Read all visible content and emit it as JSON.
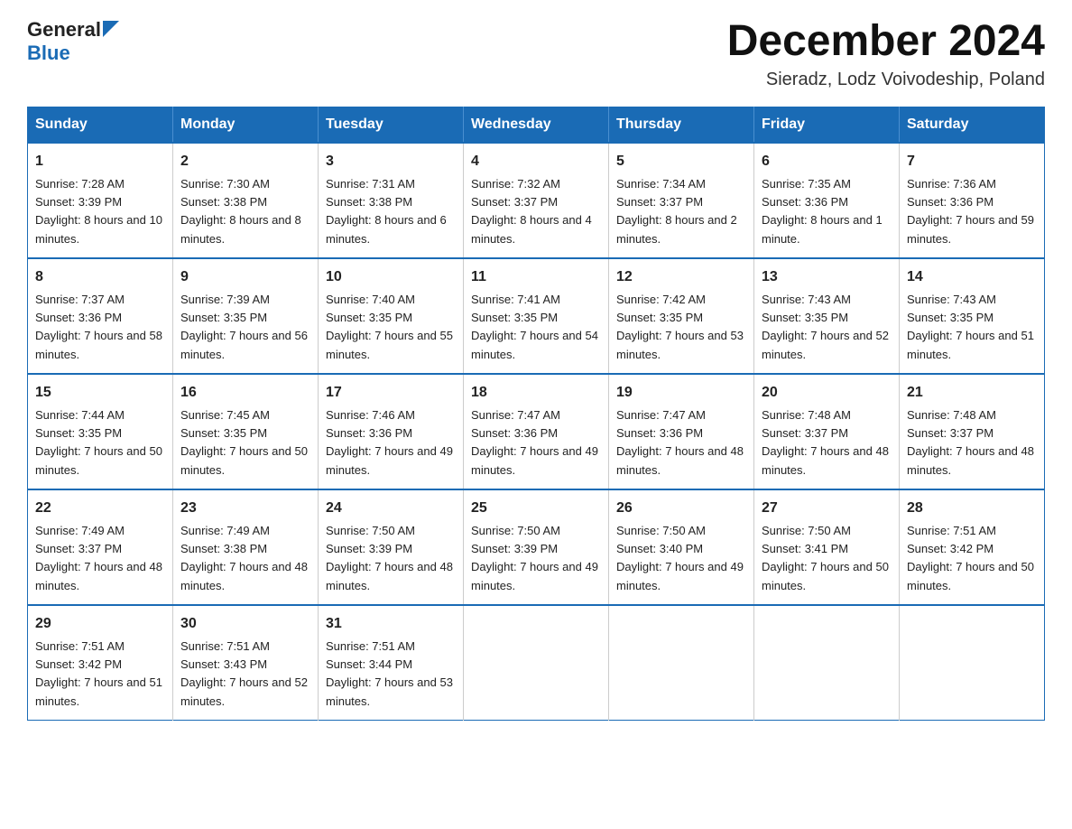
{
  "header": {
    "logo_general": "General",
    "logo_blue": "Blue",
    "title": "December 2024",
    "subtitle": "Sieradz, Lodz Voivodeship, Poland"
  },
  "weekdays": [
    "Sunday",
    "Monday",
    "Tuesday",
    "Wednesday",
    "Thursday",
    "Friday",
    "Saturday"
  ],
  "weeks": [
    [
      {
        "day": "1",
        "sunrise": "7:28 AM",
        "sunset": "3:39 PM",
        "daylight": "8 hours and 10 minutes."
      },
      {
        "day": "2",
        "sunrise": "7:30 AM",
        "sunset": "3:38 PM",
        "daylight": "8 hours and 8 minutes."
      },
      {
        "day": "3",
        "sunrise": "7:31 AM",
        "sunset": "3:38 PM",
        "daylight": "8 hours and 6 minutes."
      },
      {
        "day": "4",
        "sunrise": "7:32 AM",
        "sunset": "3:37 PM",
        "daylight": "8 hours and 4 minutes."
      },
      {
        "day": "5",
        "sunrise": "7:34 AM",
        "sunset": "3:37 PM",
        "daylight": "8 hours and 2 minutes."
      },
      {
        "day": "6",
        "sunrise": "7:35 AM",
        "sunset": "3:36 PM",
        "daylight": "8 hours and 1 minute."
      },
      {
        "day": "7",
        "sunrise": "7:36 AM",
        "sunset": "3:36 PM",
        "daylight": "7 hours and 59 minutes."
      }
    ],
    [
      {
        "day": "8",
        "sunrise": "7:37 AM",
        "sunset": "3:36 PM",
        "daylight": "7 hours and 58 minutes."
      },
      {
        "day": "9",
        "sunrise": "7:39 AM",
        "sunset": "3:35 PM",
        "daylight": "7 hours and 56 minutes."
      },
      {
        "day": "10",
        "sunrise": "7:40 AM",
        "sunset": "3:35 PM",
        "daylight": "7 hours and 55 minutes."
      },
      {
        "day": "11",
        "sunrise": "7:41 AM",
        "sunset": "3:35 PM",
        "daylight": "7 hours and 54 minutes."
      },
      {
        "day": "12",
        "sunrise": "7:42 AM",
        "sunset": "3:35 PM",
        "daylight": "7 hours and 53 minutes."
      },
      {
        "day": "13",
        "sunrise": "7:43 AM",
        "sunset": "3:35 PM",
        "daylight": "7 hours and 52 minutes."
      },
      {
        "day": "14",
        "sunrise": "7:43 AM",
        "sunset": "3:35 PM",
        "daylight": "7 hours and 51 minutes."
      }
    ],
    [
      {
        "day": "15",
        "sunrise": "7:44 AM",
        "sunset": "3:35 PM",
        "daylight": "7 hours and 50 minutes."
      },
      {
        "day": "16",
        "sunrise": "7:45 AM",
        "sunset": "3:35 PM",
        "daylight": "7 hours and 50 minutes."
      },
      {
        "day": "17",
        "sunrise": "7:46 AM",
        "sunset": "3:36 PM",
        "daylight": "7 hours and 49 minutes."
      },
      {
        "day": "18",
        "sunrise": "7:47 AM",
        "sunset": "3:36 PM",
        "daylight": "7 hours and 49 minutes."
      },
      {
        "day": "19",
        "sunrise": "7:47 AM",
        "sunset": "3:36 PM",
        "daylight": "7 hours and 48 minutes."
      },
      {
        "day": "20",
        "sunrise": "7:48 AM",
        "sunset": "3:37 PM",
        "daylight": "7 hours and 48 minutes."
      },
      {
        "day": "21",
        "sunrise": "7:48 AM",
        "sunset": "3:37 PM",
        "daylight": "7 hours and 48 minutes."
      }
    ],
    [
      {
        "day": "22",
        "sunrise": "7:49 AM",
        "sunset": "3:37 PM",
        "daylight": "7 hours and 48 minutes."
      },
      {
        "day": "23",
        "sunrise": "7:49 AM",
        "sunset": "3:38 PM",
        "daylight": "7 hours and 48 minutes."
      },
      {
        "day": "24",
        "sunrise": "7:50 AM",
        "sunset": "3:39 PM",
        "daylight": "7 hours and 48 minutes."
      },
      {
        "day": "25",
        "sunrise": "7:50 AM",
        "sunset": "3:39 PM",
        "daylight": "7 hours and 49 minutes."
      },
      {
        "day": "26",
        "sunrise": "7:50 AM",
        "sunset": "3:40 PM",
        "daylight": "7 hours and 49 minutes."
      },
      {
        "day": "27",
        "sunrise": "7:50 AM",
        "sunset": "3:41 PM",
        "daylight": "7 hours and 50 minutes."
      },
      {
        "day": "28",
        "sunrise": "7:51 AM",
        "sunset": "3:42 PM",
        "daylight": "7 hours and 50 minutes."
      }
    ],
    [
      {
        "day": "29",
        "sunrise": "7:51 AM",
        "sunset": "3:42 PM",
        "daylight": "7 hours and 51 minutes."
      },
      {
        "day": "30",
        "sunrise": "7:51 AM",
        "sunset": "3:43 PM",
        "daylight": "7 hours and 52 minutes."
      },
      {
        "day": "31",
        "sunrise": "7:51 AM",
        "sunset": "3:44 PM",
        "daylight": "7 hours and 53 minutes."
      },
      null,
      null,
      null,
      null
    ]
  ]
}
